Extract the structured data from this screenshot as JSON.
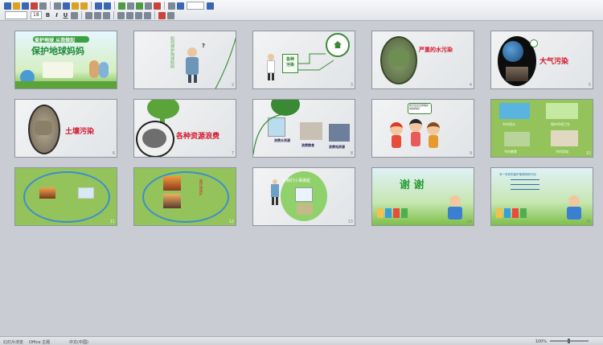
{
  "toolbar": {
    "font_name": "",
    "font_size": "18",
    "row1_icons": [
      "new-icon",
      "open-icon",
      "save-icon",
      "print-icon",
      "preview-icon",
      "cut-icon",
      "copy-icon",
      "paste-icon",
      "format-painter-icon",
      "undo-icon",
      "redo-icon",
      "table-icon",
      "chart-icon",
      "zoom-icon",
      "help-icon"
    ],
    "row2_icons": [
      "bold-icon",
      "italic-icon",
      "underline-icon",
      "shadow-icon",
      "align-left-icon",
      "align-center-icon",
      "align-right-icon",
      "bullets-icon",
      "font-color-icon"
    ],
    "bold_glyph": "B",
    "italic_glyph": "I",
    "underline_glyph": "U"
  },
  "slides": [
    {
      "index": "1",
      "title_top": "爱护地球 从我做起",
      "title_main": "保护地球妈妈"
    },
    {
      "index": "2",
      "vertical_text": "如何保护地球妈妈",
      "bubble": "?"
    },
    {
      "index": "3",
      "label": "各种污染",
      "label_line2": ""
    },
    {
      "index": "4",
      "label": "严重的水污染"
    },
    {
      "index": "5",
      "label": "大气污染"
    },
    {
      "index": "6",
      "label": "土壤污染"
    },
    {
      "index": "7",
      "label": "各种资源浪费"
    },
    {
      "index": "8",
      "caption1": "浪费水资源",
      "caption2": "浪费粮食",
      "caption3": "浪费电资源"
    },
    {
      "index": "9",
      "bubble": "我们应该怎样保护地球妈妈？"
    },
    {
      "index": "10",
      "cap1": "节约用水",
      "cap2": "保护环境卫生",
      "cap3": "节约粮食",
      "cap4": "节约用电"
    },
    {
      "index": "11"
    },
    {
      "index": "12",
      "vertical_text": "做环境保护"
    },
    {
      "index": "13",
      "label": "从我们小事做起"
    },
    {
      "index": "14",
      "label": "谢 谢"
    },
    {
      "index": "15",
      "lines": "写一写你的保护地球妈妈行动"
    }
  ],
  "colors": {
    "accent_green": "#3a8a35",
    "title_red": "#d4192e",
    "slide_green": "#93c35a"
  },
  "status": {
    "left": "幻灯片浏览",
    "mid": "Office 主题",
    "mid2": "中文(中国)",
    "zoom": "100%"
  }
}
